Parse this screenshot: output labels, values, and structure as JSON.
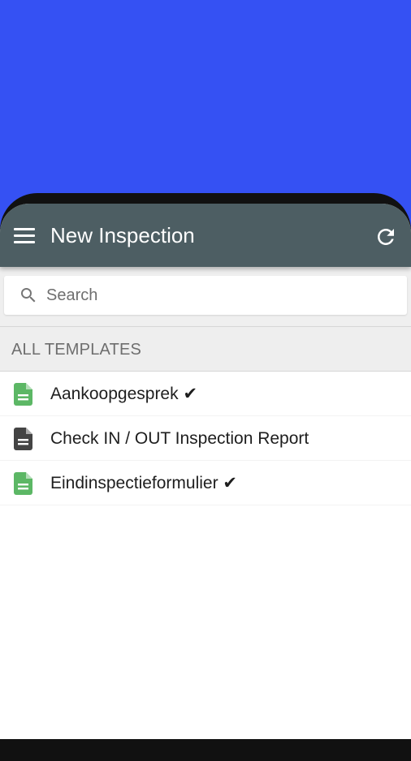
{
  "colors": {
    "background": "#3551f3",
    "appbar": "#4d5e63",
    "icon_green": "#5cb765",
    "icon_dark": "#444444"
  },
  "appbar": {
    "title": "New Inspection",
    "menu_icon": "hamburger-menu-icon",
    "refresh_icon": "refresh-icon"
  },
  "search": {
    "placeholder": "Search",
    "value": "",
    "icon": "search-icon"
  },
  "section": {
    "label": "ALL TEMPLATES"
  },
  "templates": [
    {
      "label": "Aankoopgesprek ✔",
      "icon": "document-icon",
      "icon_color": "#5cb765"
    },
    {
      "label": "Check IN / OUT Inspection Report",
      "icon": "document-icon",
      "icon_color": "#444444"
    },
    {
      "label": "Eindinspectieformulier ✔",
      "icon": "document-icon",
      "icon_color": "#5cb765"
    }
  ]
}
